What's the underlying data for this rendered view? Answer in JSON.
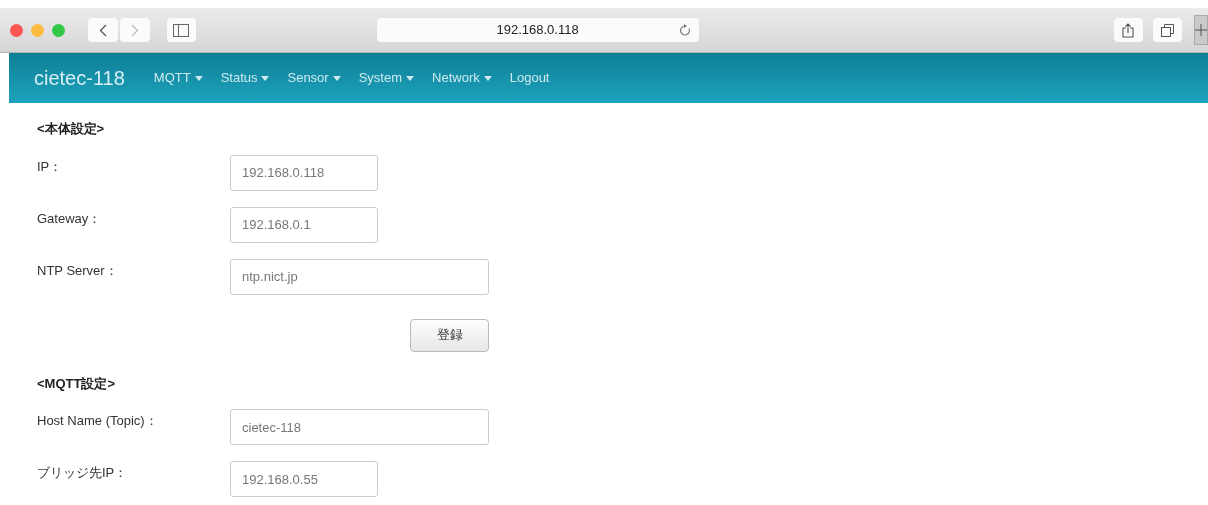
{
  "browser": {
    "address": "192.168.0.118"
  },
  "navbar": {
    "brand": "cietec-118",
    "items": [
      {
        "label": "MQTT",
        "dropdown": true
      },
      {
        "label": "Status",
        "dropdown": true
      },
      {
        "label": "Sensor",
        "dropdown": true
      },
      {
        "label": "System",
        "dropdown": true
      },
      {
        "label": "Network",
        "dropdown": true
      },
      {
        "label": "Logout",
        "dropdown": false
      }
    ]
  },
  "sections": [
    {
      "heading": "<本体設定>",
      "fields": [
        {
          "label": "IP：",
          "value": "192.168.0.118",
          "wide": false
        },
        {
          "label": "Gateway：",
          "value": "192.168.0.1",
          "wide": false
        },
        {
          "label": "NTP Server：",
          "value": "ntp.nict.jp",
          "wide": true
        }
      ],
      "button": "登録"
    },
    {
      "heading": "<MQTT設定>",
      "fields": [
        {
          "label": "Host Name (Topic)：",
          "value": "cietec-118",
          "wide": true
        },
        {
          "label": "ブリッジ先IP：",
          "value": "192.168.0.55",
          "wide": false
        }
      ]
    }
  ]
}
